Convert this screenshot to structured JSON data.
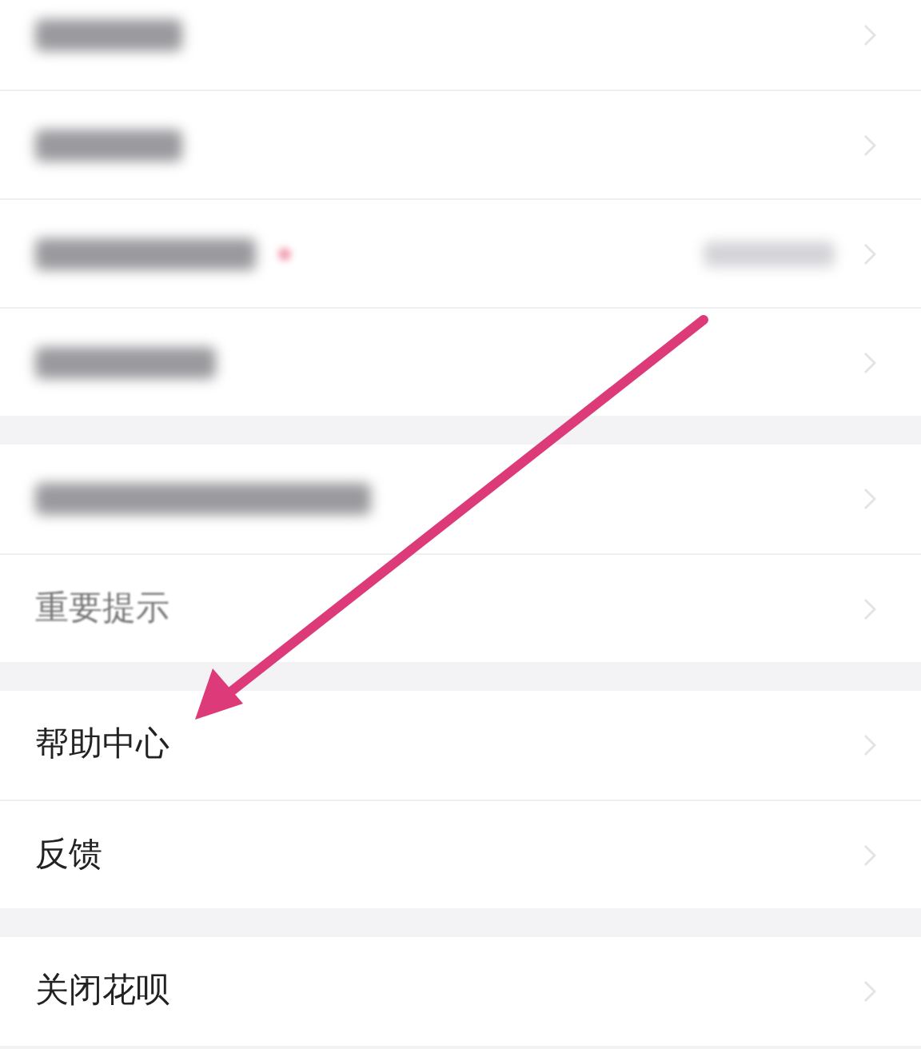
{
  "sections": [
    {
      "rows": [
        {
          "kind": "blurred",
          "badge": false,
          "value_hidden": false
        },
        {
          "kind": "blurred",
          "badge": false,
          "value_hidden": false
        },
        {
          "kind": "blurred",
          "badge": true,
          "value_hidden": true
        },
        {
          "kind": "blurred",
          "badge": false,
          "value_hidden": false
        }
      ]
    },
    {
      "rows": [
        {
          "kind": "blurred",
          "badge": false,
          "value_hidden": false
        },
        {
          "kind": "text",
          "label": "重要提示",
          "dimmed": true
        }
      ]
    },
    {
      "rows": [
        {
          "kind": "text",
          "label": "帮助中心",
          "dimmed": false
        },
        {
          "kind": "text",
          "label": "反馈",
          "dimmed": false
        }
      ]
    },
    {
      "rows": [
        {
          "kind": "text",
          "label": "关闭花呗",
          "dimmed": false
        }
      ]
    }
  ]
}
